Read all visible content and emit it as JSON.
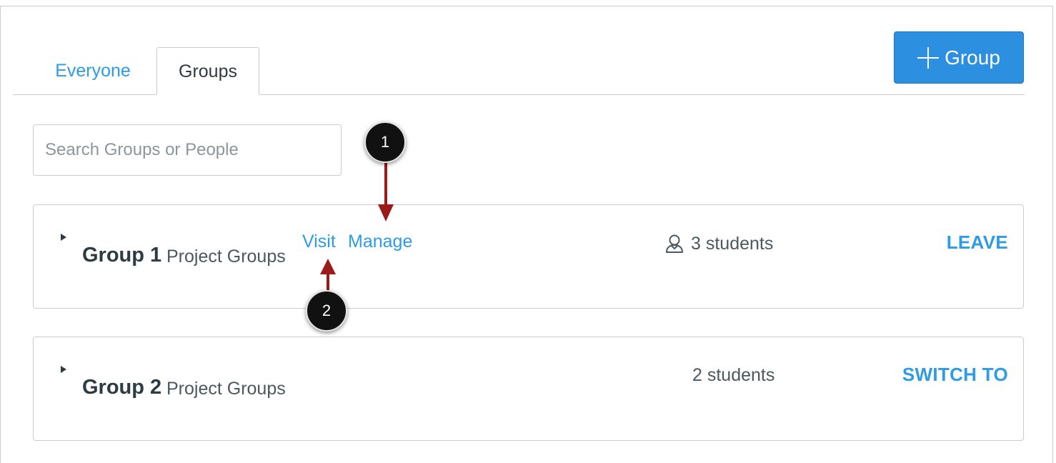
{
  "tabs": [
    {
      "label": "Everyone",
      "active": false
    },
    {
      "label": "Groups",
      "active": true
    }
  ],
  "add_group_button": {
    "label": "Group",
    "icon": "plus-icon",
    "color": "#2d8fe0"
  },
  "search": {
    "placeholder": "Search Groups or People",
    "value": ""
  },
  "groups": [
    {
      "name": "Group 1",
      "category": "Project Groups",
      "links": {
        "visit": "Visit",
        "manage": "Manage"
      },
      "student_count": "3 students",
      "action": "LEAVE"
    },
    {
      "name": "Group 2",
      "category": "Project Groups",
      "student_count": "2 students",
      "action": "SWITCH TO"
    }
  ],
  "callouts": [
    {
      "number": "1"
    },
    {
      "number": "2"
    }
  ],
  "colors": {
    "link": "#2d9be5",
    "text": "#2d3b45",
    "border": "#c7cdd1",
    "annotation_arrow": "#9b1b1b"
  }
}
